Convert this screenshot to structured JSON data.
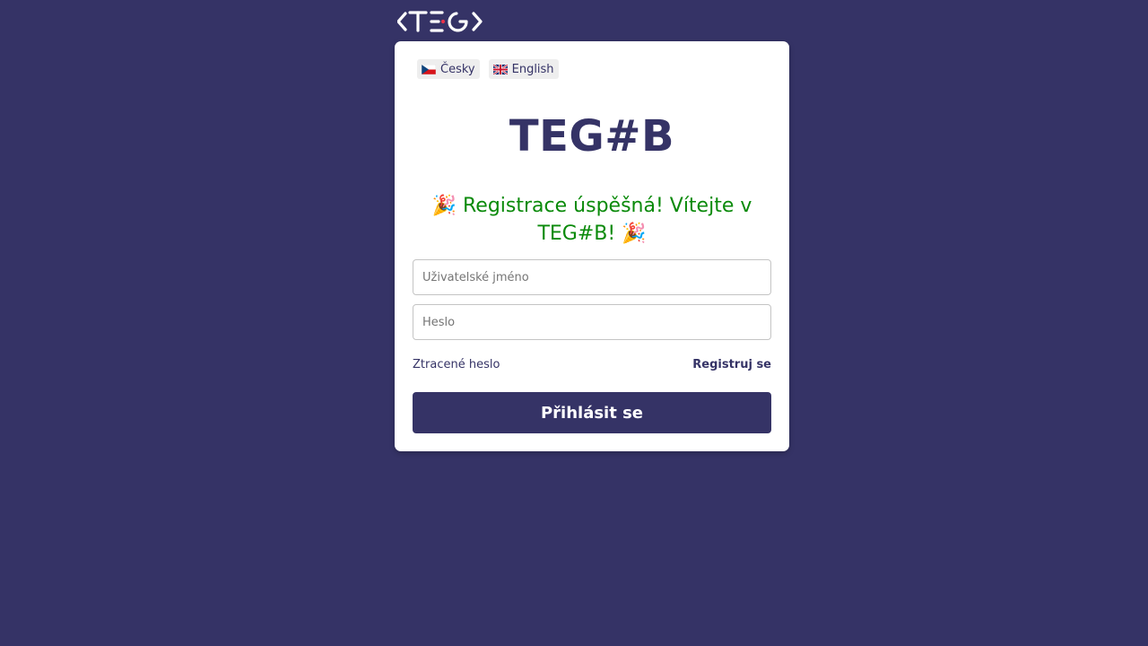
{
  "brand": {
    "logo_text": "<TEG>",
    "logo_color": "#ffffff",
    "logo_accent": "#e8334a",
    "background_color": "#353366"
  },
  "languages": [
    {
      "label": "Česky",
      "flag": "czech-flag-icon"
    },
    {
      "label": "English",
      "flag": "uk-flag-icon"
    }
  ],
  "login": {
    "title": "TEG#B",
    "success_message": "🎉 Registrace úspěšná! Vítejte v TEG#B! 🎉",
    "username_placeholder": "Uživatelské jméno",
    "password_placeholder": "Heslo",
    "forgot_password": "Ztracené heslo",
    "register": "Registruj se",
    "submit": "Přihlásit se"
  },
  "colors": {
    "primary": "#353366",
    "success": "#0a8a0a"
  }
}
